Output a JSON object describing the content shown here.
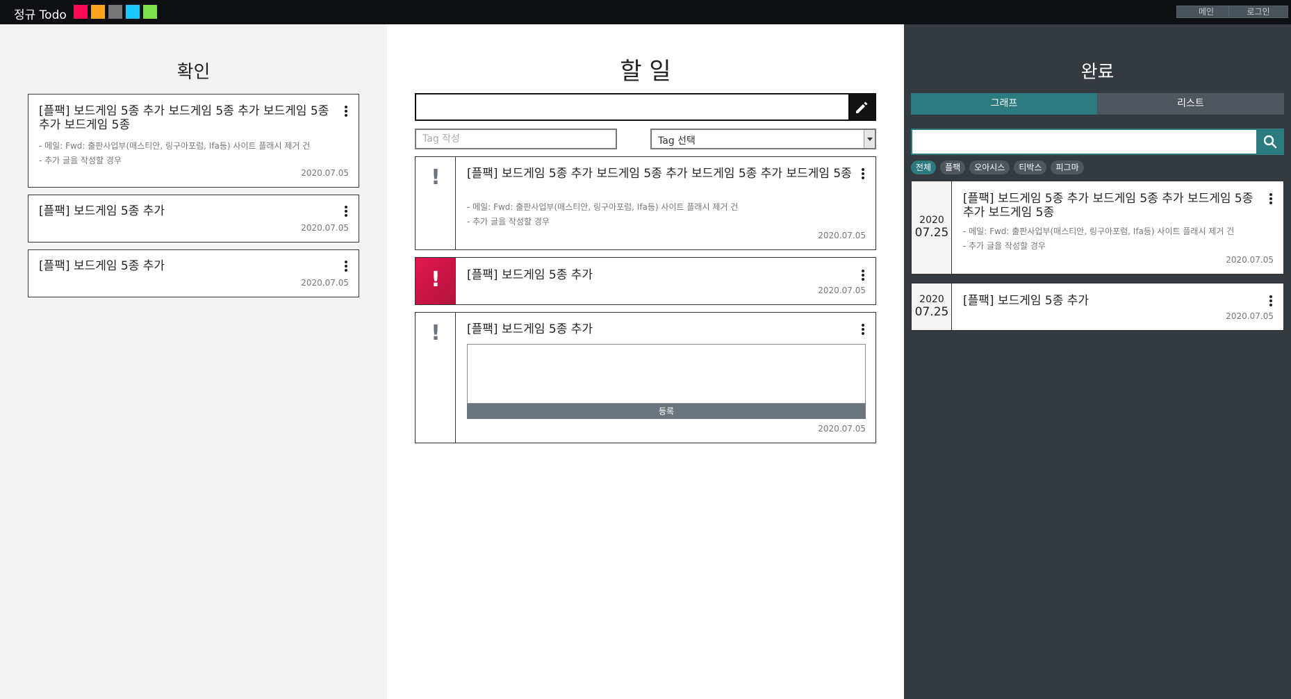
{
  "header": {
    "brand": "정규 Todo",
    "swatches": [
      "#ff0a55",
      "#ffa41b",
      "#777777",
      "#19c8ff",
      "#7ddf4a"
    ],
    "main_button": "메인",
    "login_button": "로그인"
  },
  "confirm": {
    "title": "확인",
    "cards": [
      {
        "title": "[플팩] 보드게임 5종 추가 보드게임 5종 추가 보드게임 5종 추가 보드게임 5종",
        "lines": [
          "- 메일: Fwd: 출판사업부(매스티안, 링구아포럼, Ifa등) 사이트 플래시 제거 건",
          "- 추가 글을 작성할 경우"
        ],
        "date": "2020.07.05"
      },
      {
        "title": "[플팩] 보드게임 5종 추가",
        "date": "2020.07.05"
      },
      {
        "title": "[플팩] 보드게임 5종 추가",
        "date": "2020.07.05"
      }
    ]
  },
  "todo": {
    "title": "할 일",
    "new_task_value": "",
    "tag_input_placeholder": "Tag 작성",
    "tag_select_value": "Tag 선택",
    "cards": [
      {
        "priority": "!",
        "title": "[플팩] 보드게임 5종 추가 보드게임 5종 추가 보드게임 5종 추가 보드게임 5종",
        "lines": [
          "- 메일: Fwd: 출판사업부(매스티안, 링구아포럼, Ifa등) 사이트 플래시 제거 건",
          "- 추가 글을 작성할 경우"
        ],
        "date": "2020.07.05"
      },
      {
        "priority": "!",
        "title": "[플팩] 보드게임 5종 추가",
        "date": "2020.07.05"
      },
      {
        "priority": "!",
        "title": "[플팩] 보드게임 5종 추가",
        "comment_value": "",
        "submit_label": "등록",
        "date": "2020.07.05"
      }
    ]
  },
  "done": {
    "title": "완료",
    "tab_graph": "그래프",
    "tab_list": "리스트",
    "search_value": "",
    "filters": [
      "전체",
      "플팩",
      "오아시스",
      "티박스",
      "피그마"
    ],
    "cards": [
      {
        "year": "2020",
        "day": "07.25",
        "title": "[플팩] 보드게임 5종 추가 보드게임 5종 추가 보드게임 5종 추가 보드게임 5종",
        "lines": [
          "- 메일: Fwd: 출판사업부(매스티안, 링구아포럼, Ifa등) 사이트 플래시 제거 건",
          "- 추가 글을 작성할 경우"
        ],
        "date": "2020.07.05"
      },
      {
        "year": "2020",
        "day": "07.25",
        "title": "[플팩] 보드게임 5종 추가",
        "date": "2020.07.05"
      }
    ]
  }
}
